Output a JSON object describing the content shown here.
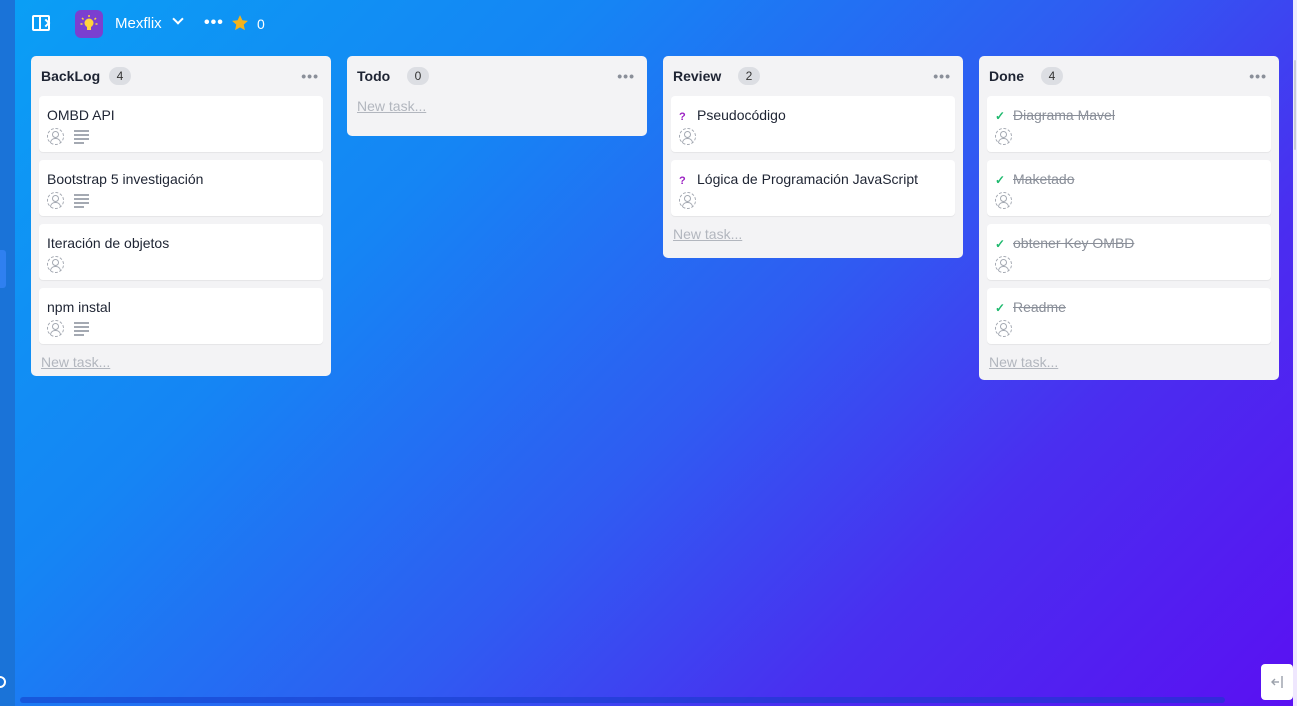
{
  "header": {
    "project_name": "Mexflix",
    "favorites_count": "0",
    "icons": {
      "sidebar": "sidebar-toggle-icon",
      "logo": "lightbulb-icon",
      "more": "more-horizontal-icon",
      "star": "star-icon"
    },
    "more_symbol": "•••"
  },
  "colors": {
    "background_start": "#0a9ff5",
    "background_end": "#5a10f2",
    "column_bg": "#f3f3f5",
    "review_prefix": "#9a1fc2",
    "done_check": "#1fb96e",
    "logo_bg": "#7b3fd0",
    "star": "#f5b31a"
  },
  "columns": [
    {
      "title": "BackLog",
      "count": "4",
      "more": "•••",
      "new_task": "New task...",
      "cards": [
        {
          "title": "OMBD API",
          "has_description": true
        },
        {
          "title": "Bootstrap 5  investigación",
          "has_description": true
        },
        {
          "title": "Iteración de objetos",
          "has_description": false
        },
        {
          "title": "npm instal",
          "has_description": true
        }
      ]
    },
    {
      "title": "Todo",
      "count": "0",
      "more": "•••",
      "new_task": "New task...",
      "cards": []
    },
    {
      "title": "Review",
      "count": "2",
      "more": "•••",
      "new_task": "New task...",
      "prefix": "?",
      "cards": [
        {
          "title": "Pseudocódigo"
        },
        {
          "title": "Lógica de Programación JavaScript"
        }
      ]
    },
    {
      "title": "Done",
      "count": "4",
      "more": "•••",
      "new_task": "New task...",
      "prefix": "✓",
      "cards": [
        {
          "title": "Diagrama Mavel"
        },
        {
          "title": "Maketado"
        },
        {
          "title": "obtener Key OMBD"
        },
        {
          "title": "Readme"
        }
      ]
    }
  ]
}
